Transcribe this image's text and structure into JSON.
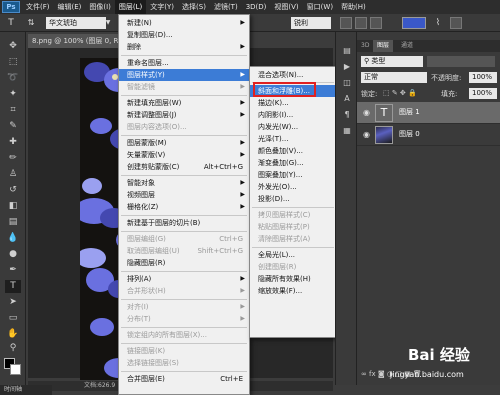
{
  "menubar": {
    "logo": "Ps",
    "items": [
      "文件(F)",
      "编辑(E)",
      "图像(I)",
      "图层(L)",
      "文字(Y)",
      "选择(S)",
      "滤镜(T)",
      "3D(D)",
      "视图(V)",
      "窗口(W)",
      "帮助(H)"
    ]
  },
  "options": {
    "font_family": "华文琥珀",
    "anti_alias": "锐利"
  },
  "document": {
    "tab": "8.png @ 100% (图层 0, RGB",
    "status": "文档:626.9"
  },
  "bottom_tab": "时间轴",
  "layer_menu": {
    "items": [
      {
        "label": "新建(N)",
        "shortcut": "",
        "submenu": true,
        "disabled": false
      },
      {
        "label": "复制图层(D)...",
        "shortcut": "",
        "submenu": false,
        "disabled": false
      },
      {
        "label": "删除",
        "shortcut": "",
        "submenu": true,
        "disabled": false
      },
      {
        "label": "重命名图层...",
        "shortcut": "",
        "submenu": false,
        "disabled": false
      },
      {
        "label": "图层样式(Y)",
        "shortcut": "",
        "submenu": true,
        "disabled": false,
        "highlight": true
      },
      {
        "label": "智能滤镜",
        "shortcut": "",
        "submenu": true,
        "disabled": true
      },
      {
        "label": "新建填充图层(W)",
        "shortcut": "",
        "submenu": true,
        "disabled": false
      },
      {
        "label": "新建调整图层(J)",
        "shortcut": "",
        "submenu": true,
        "disabled": false
      },
      {
        "label": "图层内容选项(O)...",
        "shortcut": "",
        "submenu": false,
        "disabled": true
      },
      {
        "label": "图层蒙版(M)",
        "shortcut": "",
        "submenu": true,
        "disabled": false
      },
      {
        "label": "矢量蒙版(V)",
        "shortcut": "",
        "submenu": true,
        "disabled": false
      },
      {
        "label": "创建剪贴蒙版(C)",
        "shortcut": "Alt+Ctrl+G",
        "submenu": false,
        "disabled": false
      },
      {
        "label": "智能对象",
        "shortcut": "",
        "submenu": true,
        "disabled": false
      },
      {
        "label": "视频图层",
        "shortcut": "",
        "submenu": true,
        "disabled": false
      },
      {
        "label": "栅格化(Z)",
        "shortcut": "",
        "submenu": true,
        "disabled": false
      },
      {
        "label": "新建基于图层的切片(B)",
        "shortcut": "",
        "submenu": false,
        "disabled": false
      },
      {
        "label": "图层编组(G)",
        "shortcut": "Ctrl+G",
        "submenu": false,
        "disabled": true
      },
      {
        "label": "取消图层编组(U)",
        "shortcut": "Shift+Ctrl+G",
        "submenu": false,
        "disabled": true
      },
      {
        "label": "隐藏图层(R)",
        "shortcut": "",
        "submenu": false,
        "disabled": false
      },
      {
        "label": "排列(A)",
        "shortcut": "",
        "submenu": true,
        "disabled": false
      },
      {
        "label": "合并形状(H)",
        "shortcut": "",
        "submenu": true,
        "disabled": true
      },
      {
        "label": "对齐(I)",
        "shortcut": "",
        "submenu": true,
        "disabled": true
      },
      {
        "label": "分布(T)",
        "shortcut": "",
        "submenu": true,
        "disabled": true
      },
      {
        "label": "锁定组内的所有图层(X)...",
        "shortcut": "",
        "submenu": false,
        "disabled": true
      },
      {
        "label": "链接图层(K)",
        "shortcut": "",
        "submenu": false,
        "disabled": true
      },
      {
        "label": "选择链接图层(S)",
        "shortcut": "",
        "submenu": false,
        "disabled": true
      },
      {
        "label": "合并图层(E)",
        "shortcut": "Ctrl+E",
        "submenu": false,
        "disabled": false
      }
    ]
  },
  "style_submenu": {
    "items": [
      {
        "label": "混合选项(N)...",
        "disabled": false
      },
      {
        "label": "斜面和浮雕(B)...",
        "disabled": false,
        "highlight": true
      },
      {
        "label": "描边(K)...",
        "disabled": false
      },
      {
        "label": "内阴影(I)...",
        "disabled": false
      },
      {
        "label": "内发光(W)...",
        "disabled": false
      },
      {
        "label": "光泽(T)...",
        "disabled": false
      },
      {
        "label": "颜色叠加(V)...",
        "disabled": false
      },
      {
        "label": "渐变叠加(G)...",
        "disabled": false
      },
      {
        "label": "图案叠加(Y)...",
        "disabled": false
      },
      {
        "label": "外发光(O)...",
        "disabled": false
      },
      {
        "label": "投影(D)...",
        "disabled": false
      },
      {
        "label": "拷贝图层样式(C)",
        "disabled": true
      },
      {
        "label": "粘贴图层样式(P)",
        "disabled": true
      },
      {
        "label": "清除图层样式(A)",
        "disabled": true
      },
      {
        "label": "全局光(L)...",
        "disabled": false
      },
      {
        "label": "创建图层(R)",
        "disabled": true
      },
      {
        "label": "隐藏所有效果(H)",
        "disabled": false
      },
      {
        "label": "缩放效果(F)...",
        "disabled": false
      }
    ]
  },
  "layers_panel": {
    "tabs": [
      "3D",
      "图层",
      "通道"
    ],
    "kind_label": "类型",
    "blend_mode": "正常",
    "opacity_label": "不透明度:",
    "opacity_value": "100%",
    "lock_label": "锁定:",
    "fill_label": "填充:",
    "fill_value": "100%",
    "layers": [
      {
        "name": "图层 1",
        "kind": "text",
        "thumb": "T",
        "selected": true
      },
      {
        "name": "图层 0",
        "kind": "image",
        "selected": false
      }
    ]
  },
  "watermark": {
    "text": "Bai 经验",
    "url": "jingyan.baidu.com"
  },
  "colors": {
    "highlight": "#3c7cd6",
    "annotation_box": "#e02020",
    "text_color_swatch": "#3a58c8"
  }
}
